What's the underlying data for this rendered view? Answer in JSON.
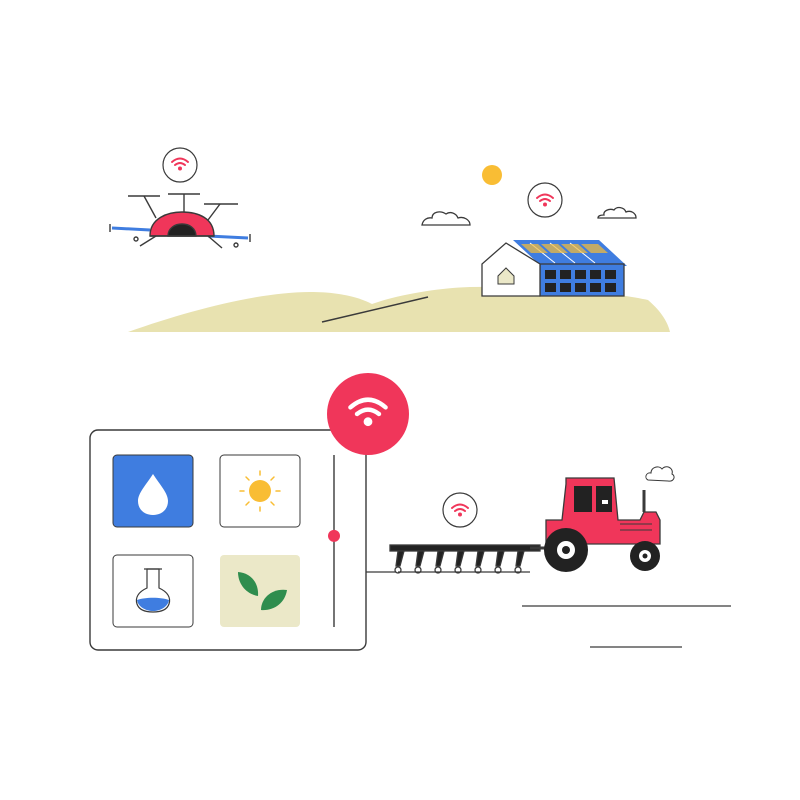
{
  "colors": {
    "outline": "#3a3a3a",
    "accent_red": "#f0365a",
    "blue": "#3f7de0",
    "sun_yellow": "#f9bd34",
    "hill": "#e8e2b0",
    "leaf_bg": "#ebe8c8",
    "leaf_green": "#2f8d4e",
    "white": "#ffffff"
  },
  "icons": {
    "drone": "drone-icon",
    "barn": "solar-barn-icon",
    "tractor": "tractor-icon",
    "plow": "plow-icon",
    "wifi": "wifi-icon",
    "water": "water-drop-icon",
    "sun": "sun-icon",
    "flask": "flask-icon",
    "leaf": "leaf-icon"
  },
  "dashboard": {
    "tiles": [
      "water",
      "sunlight",
      "soil-chemistry",
      "crop-health"
    ],
    "slider_level": 0.53
  }
}
